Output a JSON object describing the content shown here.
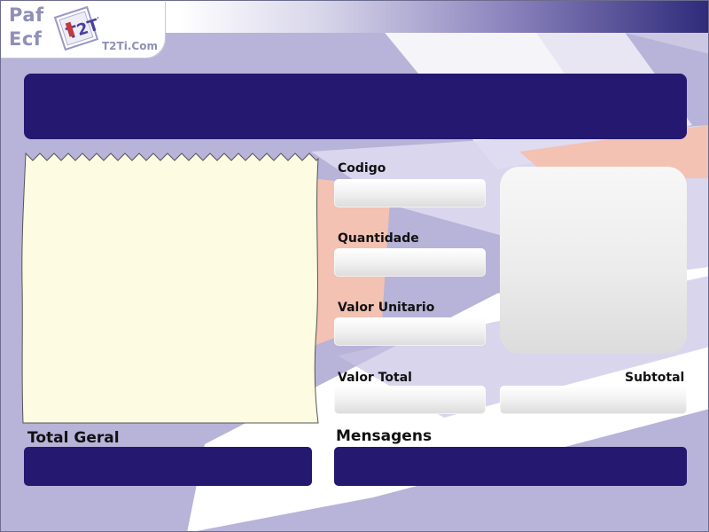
{
  "logo": {
    "line1": "Paf",
    "line2": "Ecf",
    "brand": "T2Ti.Com",
    "mark_letters": "T2Ti"
  },
  "form": {
    "codigo_label": "Codigo",
    "codigo_value": "",
    "quantidade_label": "Quantidade",
    "quantidade_value": "",
    "valor_unitario_label": "Valor Unitario",
    "valor_unitario_value": "",
    "valor_total_label": "Valor Total",
    "valor_total_value": "",
    "subtotal_label": "Subtotal",
    "subtotal_value": ""
  },
  "footer": {
    "total_geral_label": "Total Geral",
    "total_geral_value": "",
    "mensagens_label": "Mensagens",
    "mensagens_value": ""
  },
  "colors": {
    "background": "#b8b3d8",
    "dark_panel": "#241870",
    "receipt_paper": "#fdfbe2",
    "accent_salmon": "#f3c2b2"
  }
}
